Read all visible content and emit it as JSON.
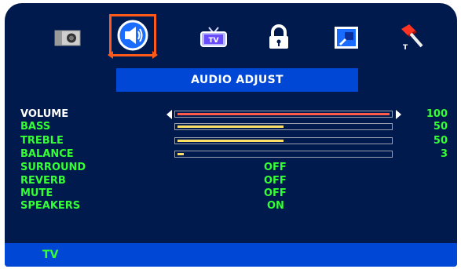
{
  "tabs": [
    {
      "icon": "camera-icon",
      "selected": false
    },
    {
      "icon": "speaker-icon",
      "selected": true
    },
    {
      "icon": "tv-icon",
      "label": "TV",
      "selected": false
    },
    {
      "icon": "lock-icon",
      "selected": false
    },
    {
      "icon": "picture-window-icon",
      "selected": false
    },
    {
      "icon": "tools-hammer-icon",
      "label": "T",
      "selected": false
    }
  ],
  "menu": {
    "title": "AUDIO ADJUST"
  },
  "settings": {
    "volume": {
      "label": "VOLUME",
      "value": "100",
      "level": 100
    },
    "bass": {
      "label": "BASS",
      "value": "50",
      "level": 50
    },
    "treble": {
      "label": "TREBLE",
      "value": "50",
      "level": 50
    },
    "balance": {
      "label": "BALANCE",
      "value": "3",
      "level": 3
    },
    "surround": {
      "label": "SURROUND",
      "value": "OFF"
    },
    "reverb": {
      "label": "REVERB",
      "value": "OFF"
    },
    "mute": {
      "label": "MUTE",
      "value": "OFF"
    },
    "speakers": {
      "label": "SPEAKERS",
      "value": "ON"
    }
  },
  "footer": {
    "source": "TV"
  },
  "colors": {
    "background": "#001a4d",
    "bar_blue": "#0047d6",
    "label_green": "#33ff33",
    "selection_orange": "#ff5a1a",
    "active_bar_red": "#ff5a4a",
    "bar_yellow": "#ffe066"
  }
}
